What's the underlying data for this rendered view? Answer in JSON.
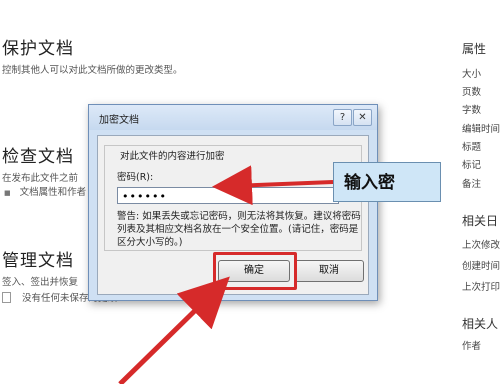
{
  "background": {
    "protect": {
      "title": "保护文档",
      "desc": "控制其他人可以对此文档所做的更改类型。"
    },
    "inspect": {
      "title": "检查文档",
      "line1": "在发布此文件之前",
      "line2": "文档属性和作者"
    },
    "manage": {
      "title": "管理文档",
      "line1": "签入、签出并恢复",
      "line2": "没有任何未保存的更改"
    }
  },
  "properties": {
    "heading": "属性",
    "items": [
      "大小",
      "页数",
      "字数",
      "编辑时间",
      "标题",
      "标记",
      "备注"
    ],
    "related_dates_heading": "相关日",
    "date_items": [
      "上次修改",
      "创建时间",
      "上次打印"
    ],
    "related_people_heading": "相关人",
    "people_items": [
      "作者"
    ]
  },
  "dialog": {
    "title": "加密文档",
    "help_label": "?",
    "close_label": "✕",
    "group_title": "对此文件的内容进行加密",
    "password_label": "密码(R):",
    "password_value": "••••••",
    "warning": "警告: 如果丢失或忘记密码，则无法将其恢复。建议将密码列表及其相应文档名放在一个安全位置。(请记住，密码是区分大小写的。)",
    "ok_label": "确定",
    "cancel_label": "取消"
  },
  "annotation": {
    "callout_text": "输入密",
    "color": "#d62a2a"
  }
}
